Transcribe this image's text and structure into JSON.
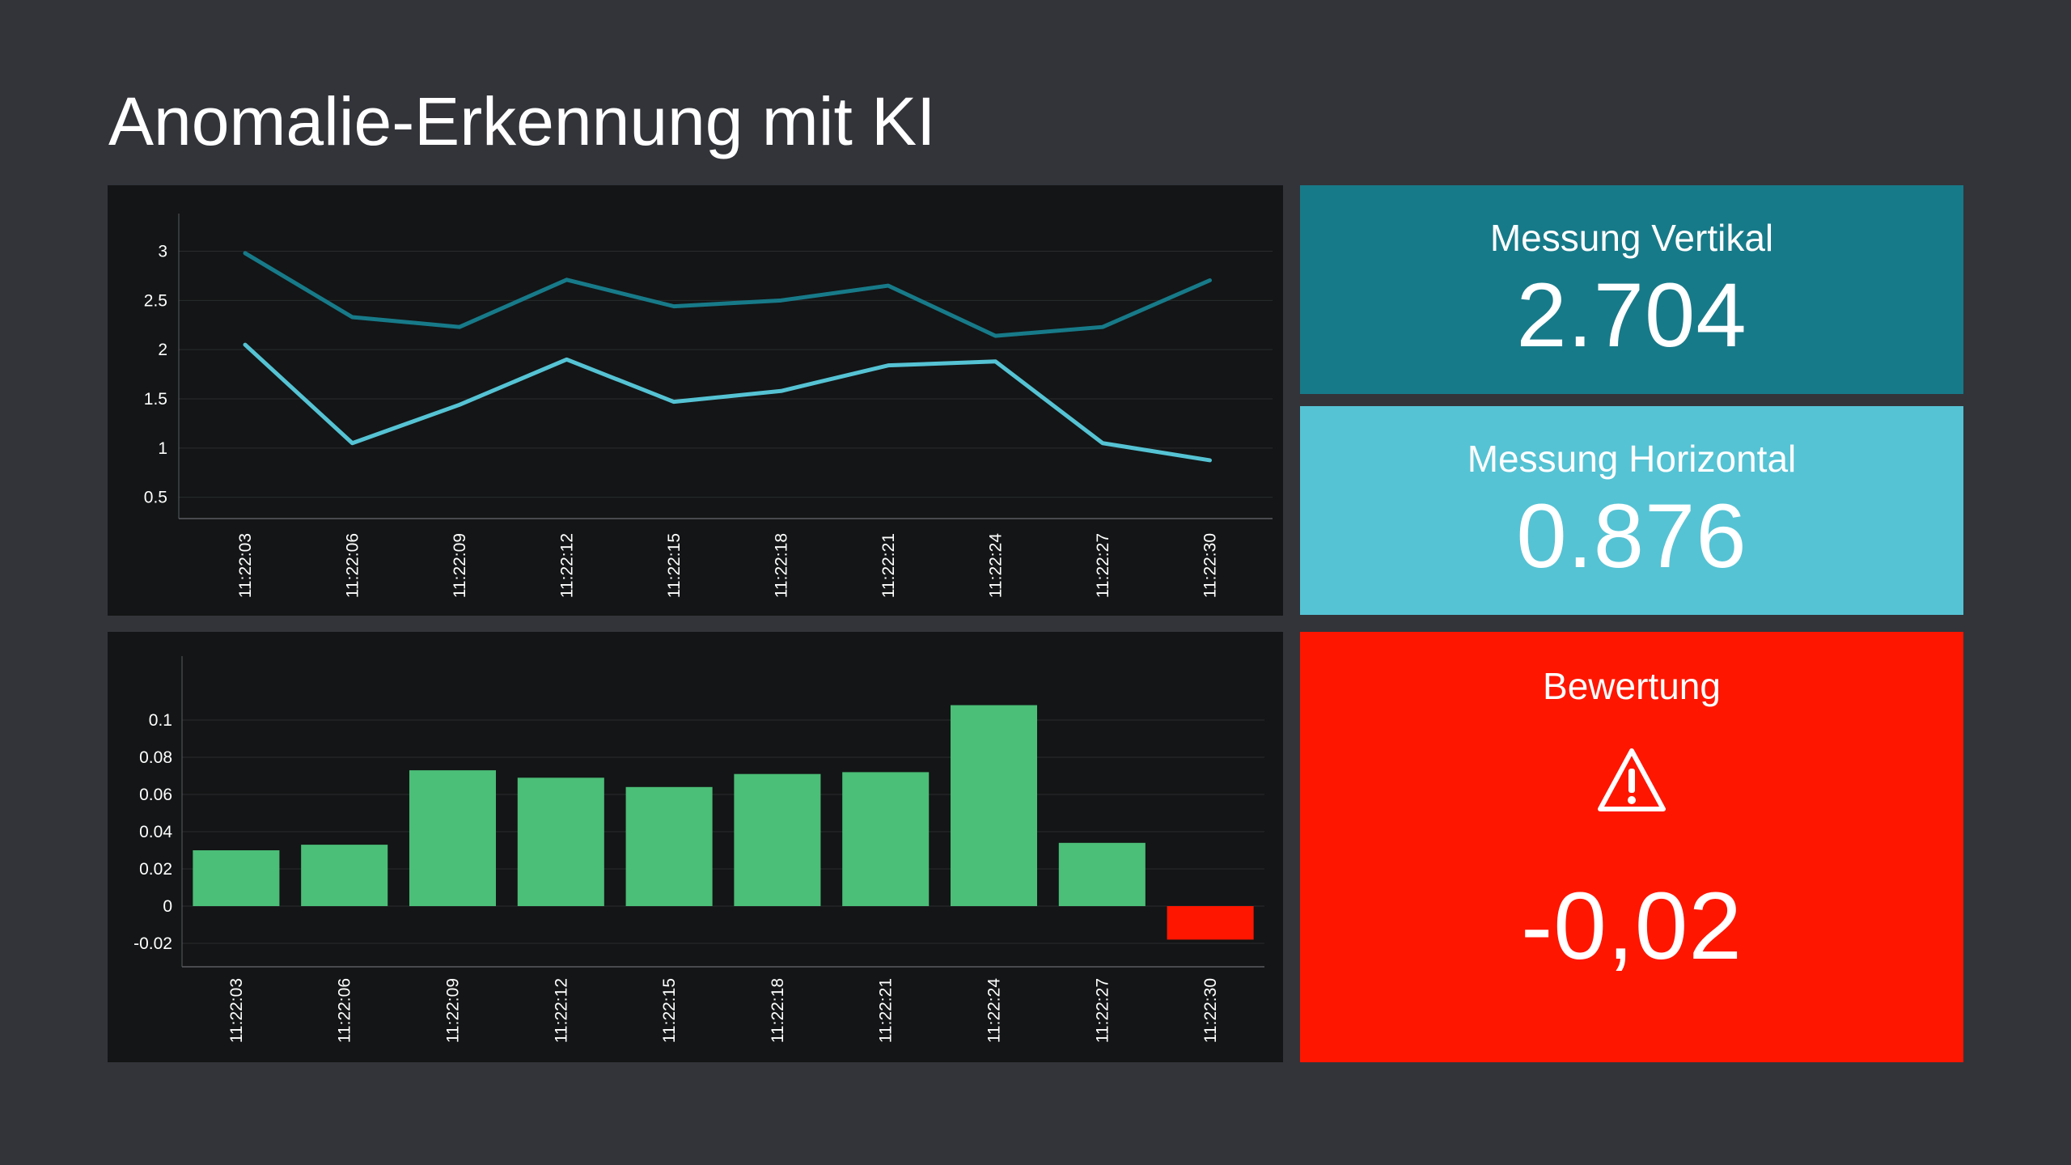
{
  "page": {
    "title": "Anomalie-Erkennung mit KI"
  },
  "tiles": {
    "vertical": {
      "label": "Messung Vertikal",
      "value": "2.704",
      "color": "#177a89"
    },
    "horizontal": {
      "label": "Messung Horizontal",
      "value": "0.876",
      "color": "#55c3d4"
    },
    "rating": {
      "label": "Bewertung",
      "value": "-0,02",
      "color": "#fe1600",
      "icon": "warning-icon"
    }
  },
  "chart_data": [
    {
      "type": "line",
      "x": [
        "11:22:03",
        "11:22:06",
        "11:22:09",
        "11:22:12",
        "11:22:15",
        "11:22:18",
        "11:22:21",
        "11:22:24",
        "11:22:27",
        "11:22:30"
      ],
      "series": [
        {
          "values": [
            2.98,
            2.33,
            2.23,
            2.71,
            2.44,
            2.5,
            2.65,
            2.14,
            2.23,
            2.704
          ],
          "color": "#177a89"
        },
        {
          "values": [
            2.05,
            1.05,
            1.44,
            1.9,
            1.47,
            1.58,
            1.84,
            1.88,
            1.05,
            0.876
          ],
          "color": "#55c3d4"
        }
      ],
      "yticks": [
        0.5,
        1,
        1.5,
        2,
        2.5,
        3
      ],
      "ylim": [
        0.3,
        3.3
      ],
      "grid": true
    },
    {
      "type": "bar",
      "categories": [
        "11:22:03",
        "11:22:06",
        "11:22:09",
        "11:22:12",
        "11:22:15",
        "11:22:18",
        "11:22:21",
        "11:22:24",
        "11:22:27",
        "11:22:30"
      ],
      "values": [
        0.03,
        0.033,
        0.073,
        0.069,
        0.064,
        0.071,
        0.072,
        0.108,
        0.034,
        -0.018
      ],
      "colors": {
        "positive": "#4bbe77",
        "negative": "#fe1600"
      },
      "yticks": [
        -0.02,
        0,
        0.02,
        0.04,
        0.06,
        0.08,
        0.1
      ],
      "ylim": [
        -0.03,
        0.13
      ],
      "grid": true
    }
  ]
}
